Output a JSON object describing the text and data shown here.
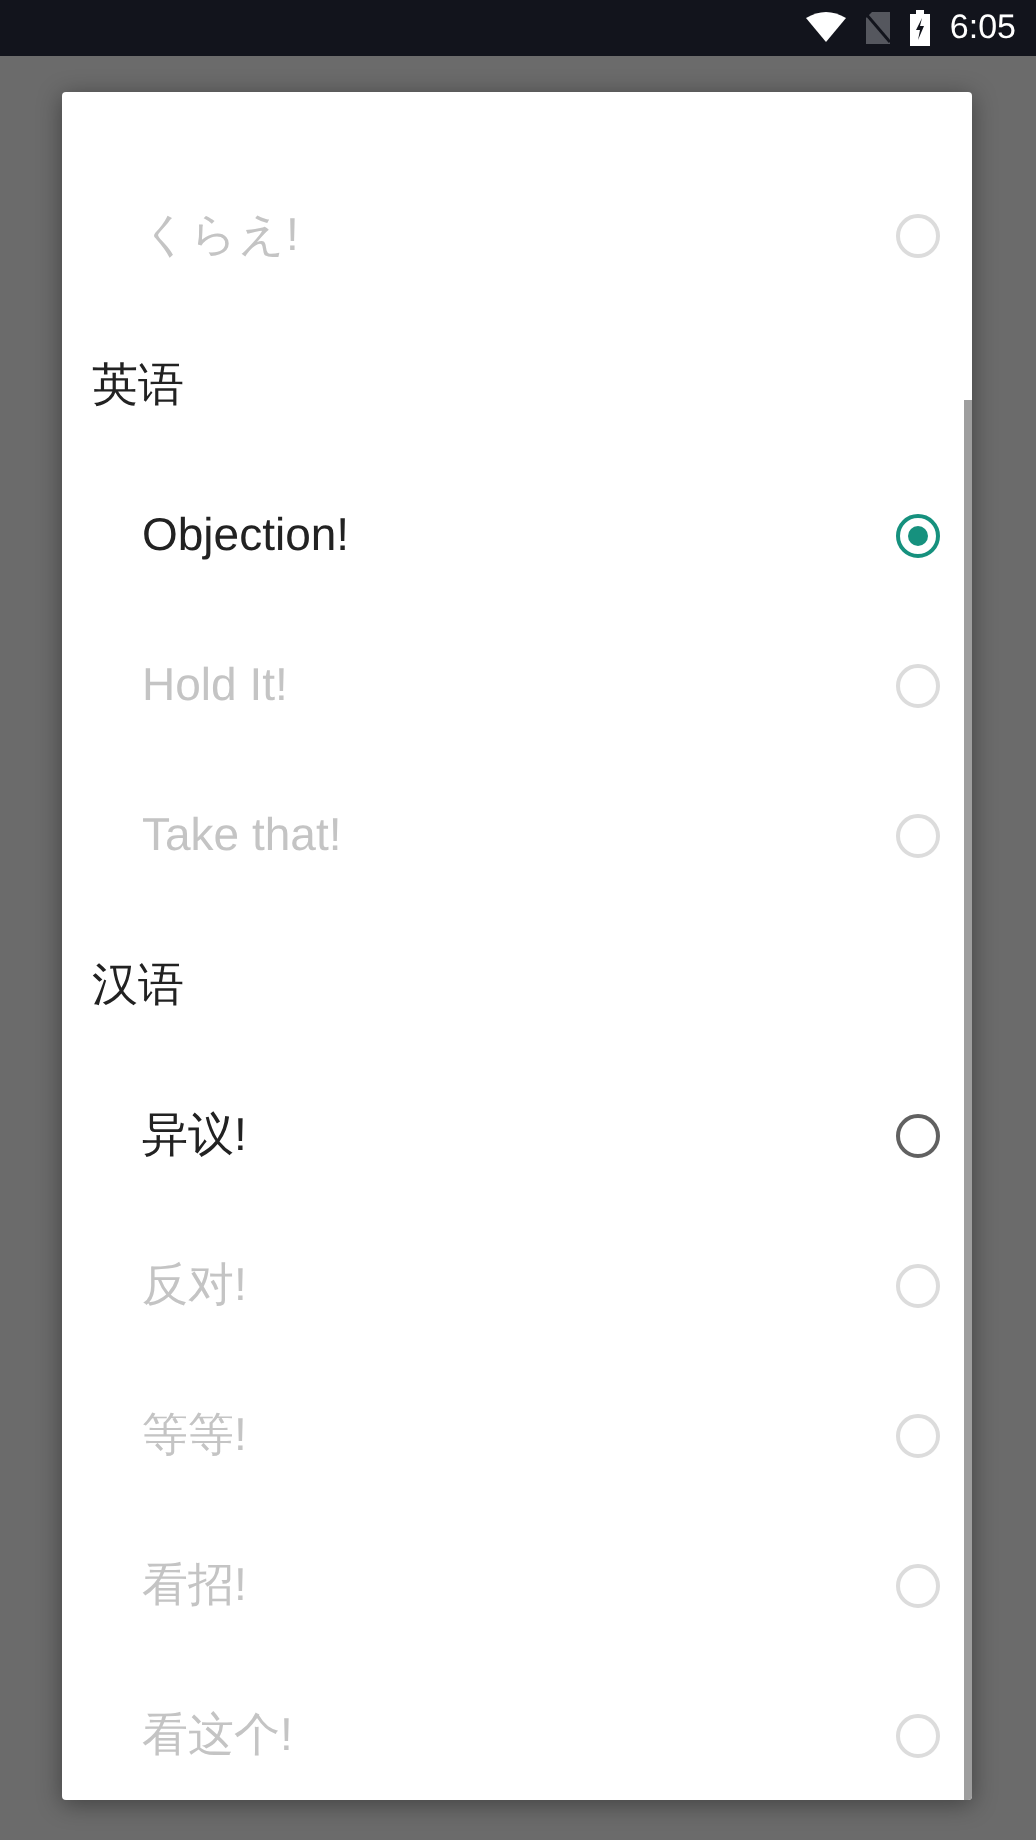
{
  "status_bar": {
    "time": "6:05"
  },
  "sections": [
    {
      "items": [
        {
          "label": "くらえ!",
          "selected": false,
          "disabled": true
        }
      ]
    },
    {
      "title": "英语",
      "items": [
        {
          "label": "Objection!",
          "selected": true,
          "disabled": false
        },
        {
          "label": "Hold It!",
          "selected": false,
          "disabled": true
        },
        {
          "label": "Take that!",
          "selected": false,
          "disabled": true
        }
      ]
    },
    {
      "title": "汉语",
      "items": [
        {
          "label": "异议!",
          "selected": false,
          "disabled": false
        },
        {
          "label": "反对!",
          "selected": false,
          "disabled": true
        },
        {
          "label": "等等!",
          "selected": false,
          "disabled": true
        },
        {
          "label": "看招!",
          "selected": false,
          "disabled": true
        },
        {
          "label": "看这个!",
          "selected": false,
          "disabled": true
        }
      ]
    }
  ]
}
